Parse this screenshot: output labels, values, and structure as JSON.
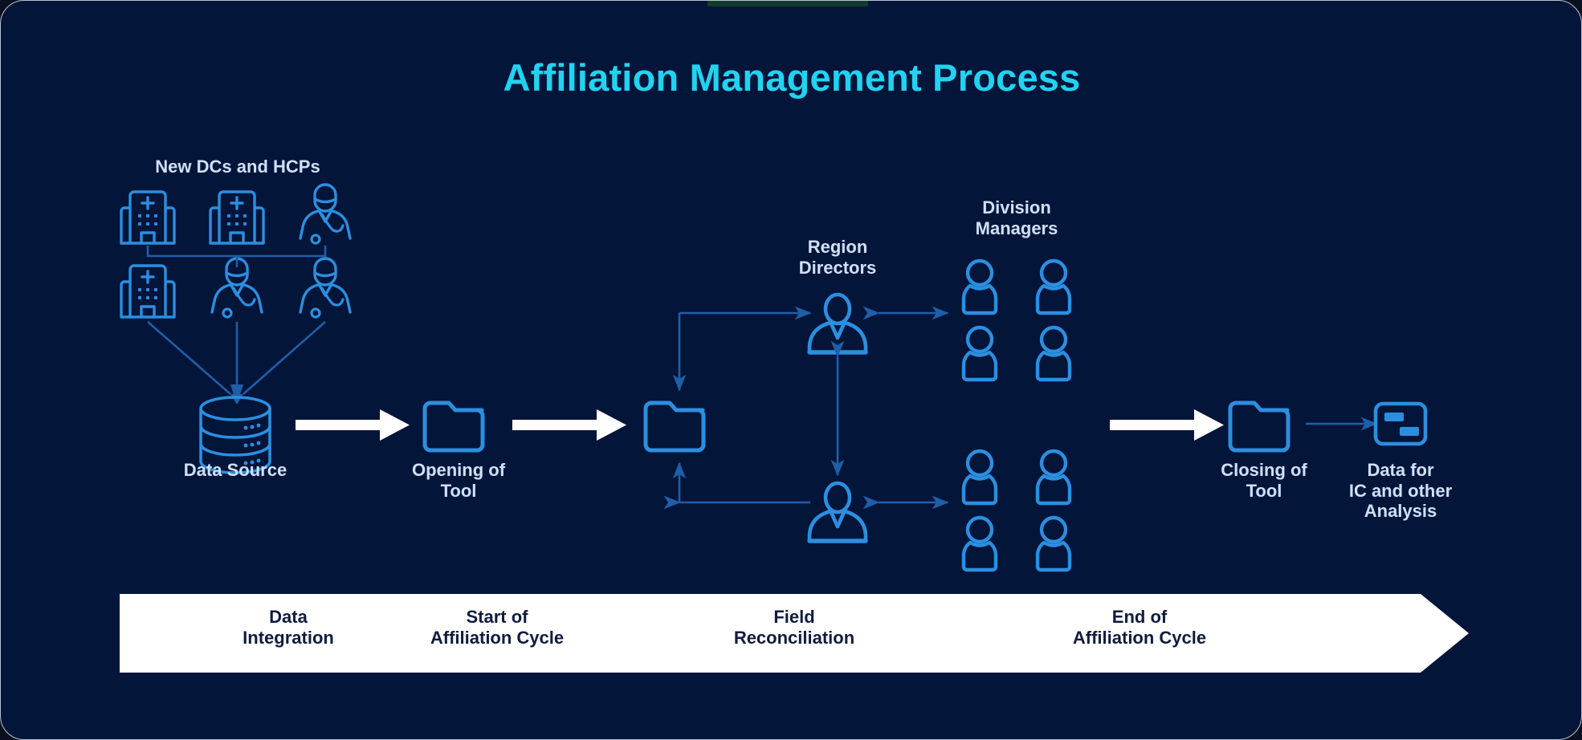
{
  "page": {
    "title": "Affiliation Management Process",
    "background_color": "#04153a",
    "title_color": "#22d3f0",
    "icon_color": "#2b8fe0",
    "connector_color": "#1f5fa8",
    "white_arrow_color": "#ffffff",
    "label_color": "#cfe0fa",
    "banner_color": "#ffffff",
    "banner_text_color": "#101c3d"
  },
  "diagram": {
    "type": "process-flow",
    "stages": [
      {
        "id": "sources",
        "label": "New DCs and HCPs",
        "icon": "hospital-and-doctor-group-icon"
      },
      {
        "id": "data-source",
        "label": "Data Source",
        "icon": "database-icon"
      },
      {
        "id": "opening-tool",
        "label": "Opening of\nTool",
        "icon": "folder-icon"
      },
      {
        "id": "reconcile",
        "label": "",
        "icon": "folder-icon"
      },
      {
        "id": "closing-tool",
        "label": "Closing of\nTool",
        "icon": "folder-icon"
      },
      {
        "id": "ic-analysis",
        "label": "Data for\nIC and other\nAnalysis",
        "icon": "report-icon"
      }
    ],
    "groups": [
      {
        "id": "region-directors",
        "label": "Region\nDirectors",
        "icon": "manager-person-icon",
        "count": 2
      },
      {
        "id": "division-managers",
        "label": "Division\nManagers",
        "icon": "user-avatar-icon",
        "count": 8
      }
    ],
    "source_icons": [
      "hospital-icon",
      "hospital-icon",
      "doctor-icon",
      "hospital-icon",
      "doctor-icon",
      "doctor-icon"
    ],
    "main_arrows": 3,
    "main_arrow_style": "white-solid-arrow"
  },
  "timeline": {
    "shape": "arrow-banner",
    "steps": [
      {
        "label": "Data\nIntegration"
      },
      {
        "label": "Start of\nAffiliation Cycle"
      },
      {
        "label": "Field\nReconciliation"
      },
      {
        "label": "End of\nAffiliation Cycle"
      }
    ]
  }
}
